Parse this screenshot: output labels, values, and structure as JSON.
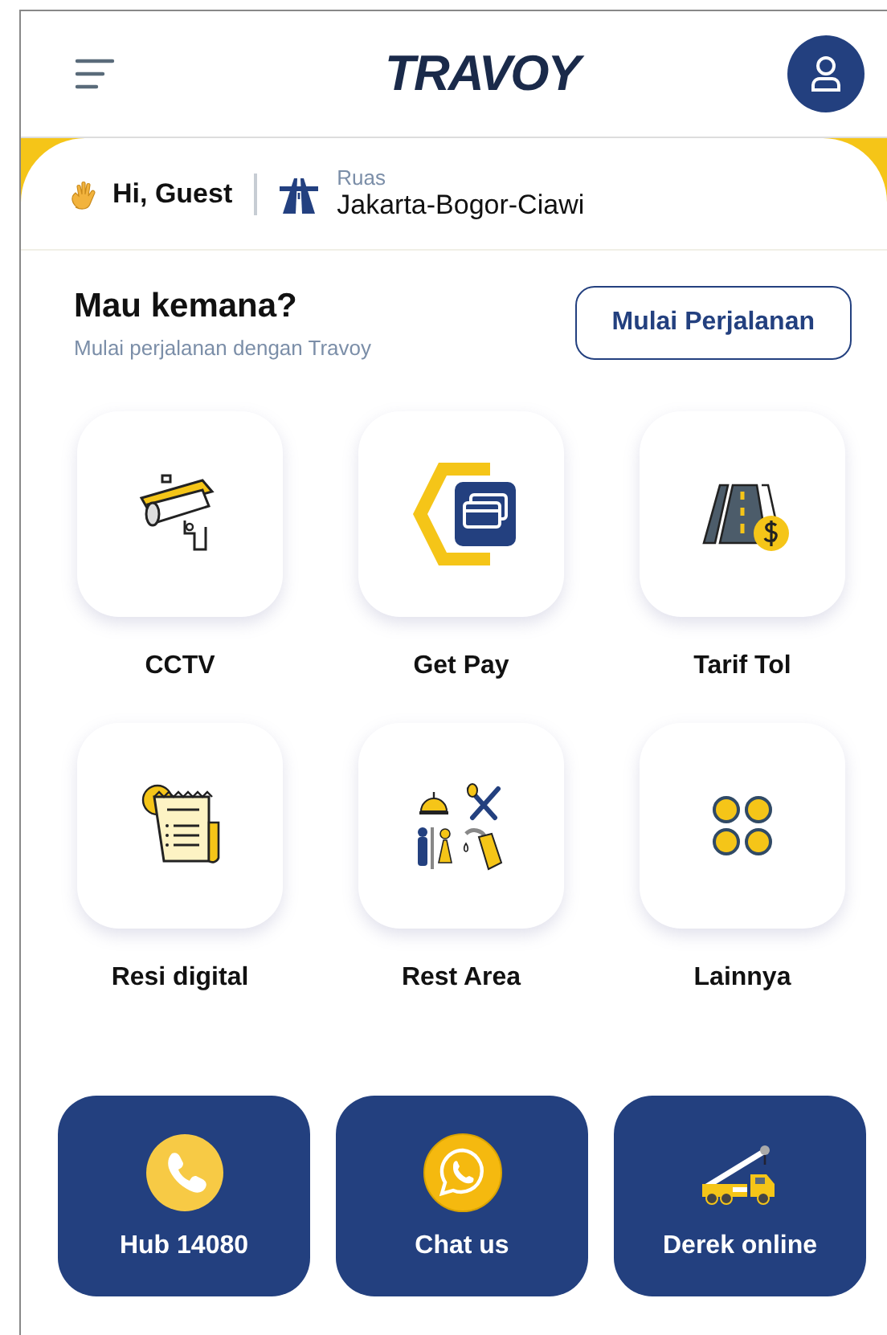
{
  "header": {
    "logo": "TRAVOY"
  },
  "greeting": {
    "text": "Hi, Guest",
    "route_label": "Ruas",
    "route": "Jakarta-Bogor-Ciawi"
  },
  "trip": {
    "title": "Mau kemana?",
    "subtitle": "Mulai perjalanan dengan Travoy",
    "button": "Mulai Perjalanan"
  },
  "services": [
    {
      "label": "CCTV"
    },
    {
      "label": "Get Pay"
    },
    {
      "label": "Tarif Tol"
    },
    {
      "label": "Resi digital"
    },
    {
      "label": "Rest Area"
    },
    {
      "label": "Lainnya"
    }
  ],
  "contacts": [
    {
      "label": "Hub 14080"
    },
    {
      "label": "Chat us"
    },
    {
      "label": "Derek online"
    }
  ]
}
